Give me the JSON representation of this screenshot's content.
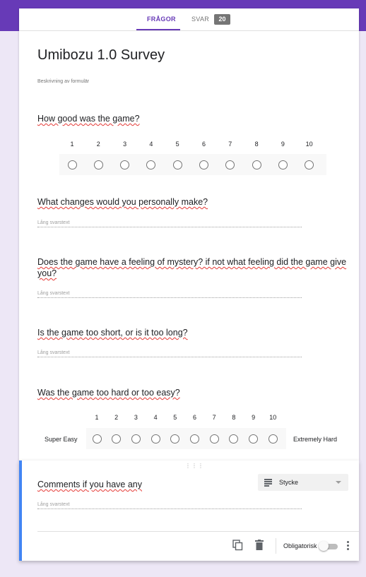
{
  "tabs": {
    "questions_label": "FRÅGOR",
    "answers_label": "SVAR",
    "answers_count": "20"
  },
  "form": {
    "title": "Umibozu 1.0 Survey",
    "description_placeholder": "Beskrivning av formulär"
  },
  "questions": [
    {
      "title": "How good was the game?",
      "type": "linear-scale",
      "scale": [
        "1",
        "2",
        "3",
        "4",
        "5",
        "6",
        "7",
        "8",
        "9",
        "10"
      ]
    },
    {
      "title": "What changes would you personally make?",
      "type": "paragraph",
      "answer_placeholder": "Lång svarstext"
    },
    {
      "title": "Does the game have a feeling of mystery? if not what feeling did the game give you?",
      "type": "paragraph",
      "answer_placeholder": "Lång svarstext"
    },
    {
      "title": "Is the game too short, or is it too long?",
      "type": "paragraph",
      "answer_placeholder": "Lång svarstext"
    },
    {
      "title": "Was the game too hard or too easy?",
      "type": "linear-scale",
      "scale": [
        "1",
        "2",
        "3",
        "4",
        "5",
        "6",
        "7",
        "8",
        "9",
        "10"
      ],
      "min_label": "Super Easy",
      "max_label": "Extremely Hard"
    }
  ],
  "active_question": {
    "title": "Comments if you have any",
    "answer_placeholder": "Lång svarstext",
    "type_select_label": "Stycke",
    "required_label": "Obligatorisk",
    "required": false
  },
  "colors": {
    "accent": "#673ab7",
    "background": "#ede7f6",
    "active_border": "#4285f4"
  }
}
